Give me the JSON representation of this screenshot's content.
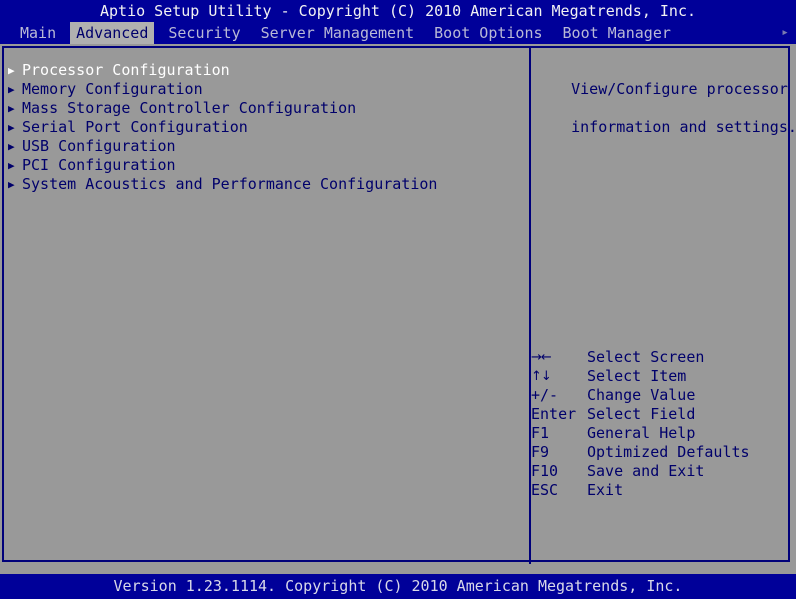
{
  "header": {
    "title": "Aptio Setup Utility - Copyright (C) 2010 American Megatrends, Inc."
  },
  "tabs": {
    "items": [
      {
        "label": "Main",
        "active": false
      },
      {
        "label": "Advanced",
        "active": true
      },
      {
        "label": "Security",
        "active": false
      },
      {
        "label": "Server Management",
        "active": false
      },
      {
        "label": "Boot Options",
        "active": false
      },
      {
        "label": "Boot Manager",
        "active": false
      }
    ],
    "scroll_right_icon": "▸"
  },
  "menu": {
    "bullet_icon": "▶",
    "items": [
      {
        "label": "Processor Configuration",
        "selected": true
      },
      {
        "label": "Memory Configuration",
        "selected": false
      },
      {
        "label": "Mass Storage Controller Configuration",
        "selected": false
      },
      {
        "label": "Serial Port Configuration",
        "selected": false
      },
      {
        "label": "USB Configuration",
        "selected": false
      },
      {
        "label": "PCI Configuration",
        "selected": false
      },
      {
        "label": "System Acoustics and Performance Configuration",
        "selected": false
      }
    ]
  },
  "help": {
    "line1": "View/Configure processor",
    "line2": "information and settings."
  },
  "keys": {
    "rows": [
      {
        "key": "→←",
        "desc": "Select Screen",
        "glyph": true
      },
      {
        "key": "↑↓",
        "desc": "Select Item",
        "glyph": true
      },
      {
        "key": "+/-",
        "desc": "Change Value",
        "glyph": false
      },
      {
        "key": "Enter",
        "desc": "Select Field",
        "glyph": false
      },
      {
        "key": "F1",
        "desc": "General Help",
        "glyph": false
      },
      {
        "key": "F9",
        "desc": "Optimized Defaults",
        "glyph": false
      },
      {
        "key": "F10",
        "desc": "Save and Exit",
        "glyph": false
      },
      {
        "key": "ESC",
        "desc": "Exit",
        "glyph": false
      }
    ]
  },
  "footer": {
    "text": "Version 1.23.1114. Copyright (C) 2010 American Megatrends, Inc."
  },
  "colors": {
    "blue_bar": "#000099",
    "panel_gray": "#999999",
    "text_navy": "#00006b",
    "selected_white": "#ffffff",
    "tab_active_bg": "#b0b0b0",
    "frame_border": "#00007a"
  }
}
